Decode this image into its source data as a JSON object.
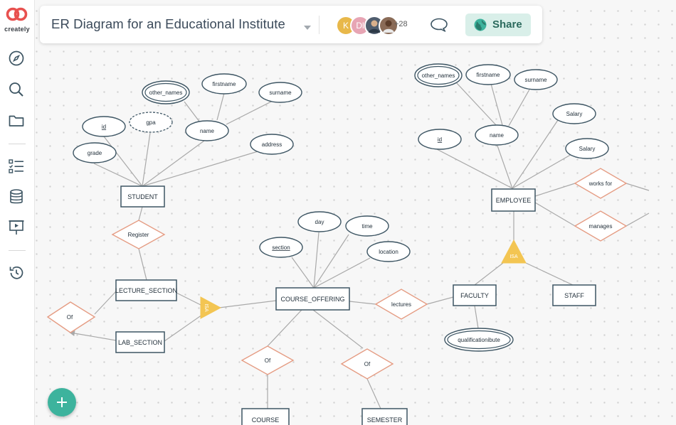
{
  "app": {
    "logo_text": "creately"
  },
  "document": {
    "title": "ER Diagram for an Educational Institute"
  },
  "collaborators": {
    "avatars": [
      {
        "initial": "K",
        "color": "#e8b84a"
      },
      {
        "initial": "Dl",
        "color": "#e7a5b4"
      },
      {
        "initial": "",
        "color": "#4f5d6e"
      },
      {
        "initial": "",
        "color": "#8a6b57"
      }
    ],
    "more_count": "+28"
  },
  "toolbar": {
    "share_label": "Share"
  },
  "sidebar": {
    "items": [
      {
        "name": "explore",
        "icon": "compass-icon"
      },
      {
        "name": "search",
        "icon": "search-icon"
      },
      {
        "name": "folders",
        "icon": "folder-icon"
      },
      {
        "name": "tasks",
        "icon": "checklist-icon"
      },
      {
        "name": "data",
        "icon": "database-icon"
      },
      {
        "name": "present",
        "icon": "presentation-icon"
      },
      {
        "name": "history",
        "icon": "history-icon"
      }
    ]
  },
  "colors": {
    "entity_border": "#3d5563",
    "attribute_border": "#3d5563",
    "relationship_border": "#e59c83",
    "isa_fill": "#f3c552",
    "connector": "#a9a9a9",
    "brand_red": "#e8514f",
    "accent_green": "#3db39d"
  },
  "diagram": {
    "entities": {
      "student": "STUDENT",
      "lecture_section": "LECTURE_SECTION",
      "lab_section": "LAB_SECTION",
      "course_offering": "COURSE_OFFERING",
      "faculty": "FACULTY",
      "staff": "STAFF",
      "employee": "EMPLOYEE",
      "course": "COURSE",
      "semester": "SEMESTER"
    },
    "attributes": {
      "s_other_names": "other_names",
      "s_firstname": "firstname",
      "s_surname": "surname",
      "s_id": "id",
      "s_gpa": "gpa",
      "s_name": "name",
      "s_grade": "grade",
      "s_address": "address",
      "co_day": "day",
      "co_time": "time",
      "co_section": "section",
      "co_location": "location",
      "e_other_names": "other_names",
      "e_firstname": "firstname",
      "e_surname": "surname",
      "e_salary1": "Salary",
      "e_id": "id",
      "e_name": "name",
      "e_salary2": "Salary",
      "f_qualification": "qualificationibute"
    },
    "relationships": {
      "register": "Register",
      "of_left": "Of",
      "lectures": "lectures",
      "works_for": "works for",
      "manages": "manages",
      "of_course": "Of",
      "of_semester": "Of"
    },
    "isa": {
      "left": "ISA",
      "right": "ISA"
    }
  }
}
